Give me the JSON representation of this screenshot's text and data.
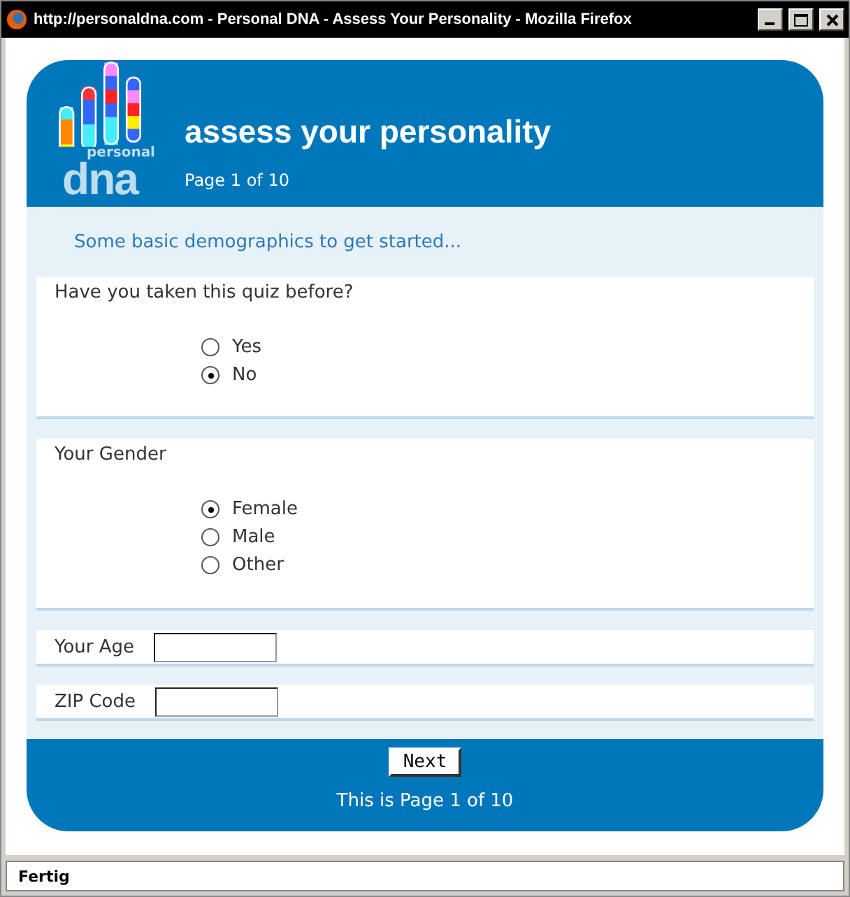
{
  "window": {
    "title": "http://personaldna.com - Personal DNA - Assess Your Personality - Mozilla Firefox"
  },
  "logo": {
    "small_text": "personal",
    "big_text": "dna"
  },
  "header": {
    "title": "assess your personality",
    "page": "Page 1 of 10"
  },
  "intro": "Some basic demographics to get started...",
  "questions": [
    {
      "label": "Have you taken this quiz before?",
      "options": [
        {
          "label": "Yes",
          "selected": false
        },
        {
          "label": "No",
          "selected": true
        }
      ]
    },
    {
      "label": "Your Gender",
      "options": [
        {
          "label": "Female",
          "selected": true
        },
        {
          "label": "Male",
          "selected": false
        },
        {
          "label": "Other",
          "selected": false
        }
      ]
    }
  ],
  "fields": [
    {
      "label": "Your Age"
    },
    {
      "label": "ZIP Code"
    }
  ],
  "footer": {
    "button": "Next",
    "page": "This is Page 1 of 10"
  },
  "status_bar": "Fertig"
}
